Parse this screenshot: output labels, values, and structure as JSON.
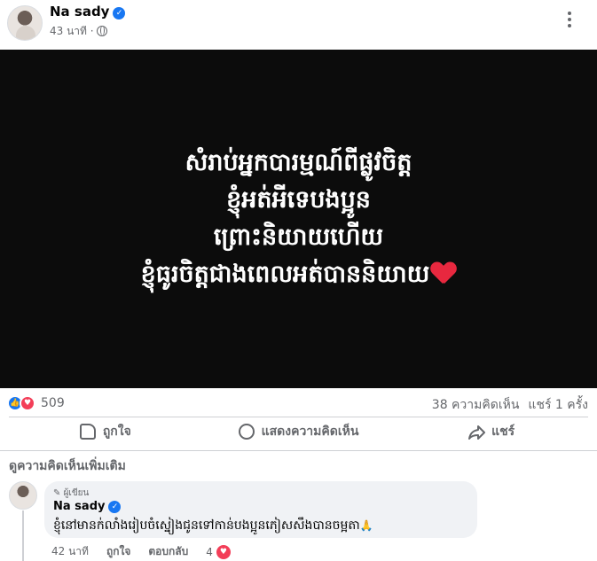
{
  "post": {
    "author": "Na sady",
    "time": "43 นาที",
    "media_lines": [
      "សំរាប់អ្នកបារម្មណ៍ពីផ្លូវចិត្ត",
      "ខ្ញុំអត់អីទេបងប្អូន",
      "ព្រោះនិយាយហើយ",
      "ខ្ញុំធូរចិត្តជាងពេលអត់បាននិយាយ"
    ],
    "reaction_count": "509",
    "comment_count": "38 ความคิดเห็น",
    "share_count": "แชร์ 1 ครั้ง"
  },
  "actions": {
    "like": "ถูกใจ",
    "comment": "แสดงความคิดเห็น",
    "share": "แชร์"
  },
  "comments": {
    "more_label": "ดูความคิดเห็นเพิ่มเติม",
    "items": [
      {
        "badge": "ผู้เขียน",
        "author": "Na sady",
        "text": "ខ្ញុំនៅមានក់លាំងរៀបចំស្នៀងជូនទៅកាន់បងប្អូនភៀសសឹងបានចម្អតា",
        "time": "42 นาที",
        "like_label": "ถูกใจ",
        "reply_label": "ตอบกลับ",
        "reaction_count": "4"
      }
    ]
  },
  "icons": {
    "verified": "verified-badge-icon",
    "globe": "globe-icon",
    "more": "more-options-icon"
  },
  "colors": {
    "brand": "#1877f2",
    "love": "#f33e58",
    "media_bg": "#0c0c0c",
    "secondary_text": "#65676b"
  }
}
